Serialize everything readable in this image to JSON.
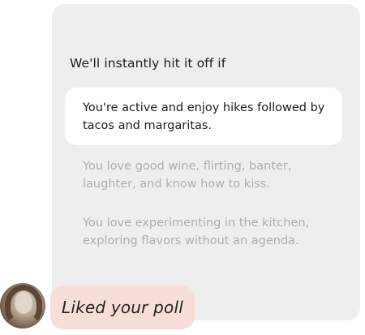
{
  "poll": {
    "prompt": "We'll instantly hit it off if",
    "options": [
      {
        "text": "You're active and enjoy hikes followed by tacos and margaritas.",
        "selected": true
      },
      {
        "text": "You love good wine, flirting, banter, laughter, and know how to kiss.",
        "selected": false
      },
      {
        "text": "You love experimenting in the kitchen, exploring flavors without an agenda.",
        "selected": false
      }
    ]
  },
  "reaction": {
    "text": "Liked your poll"
  },
  "colors": {
    "card_bg": "#eeeeef",
    "selected_bg": "#ffffff",
    "dim_text": "#aeaeb2",
    "reaction_bg": "#f7ded9"
  }
}
